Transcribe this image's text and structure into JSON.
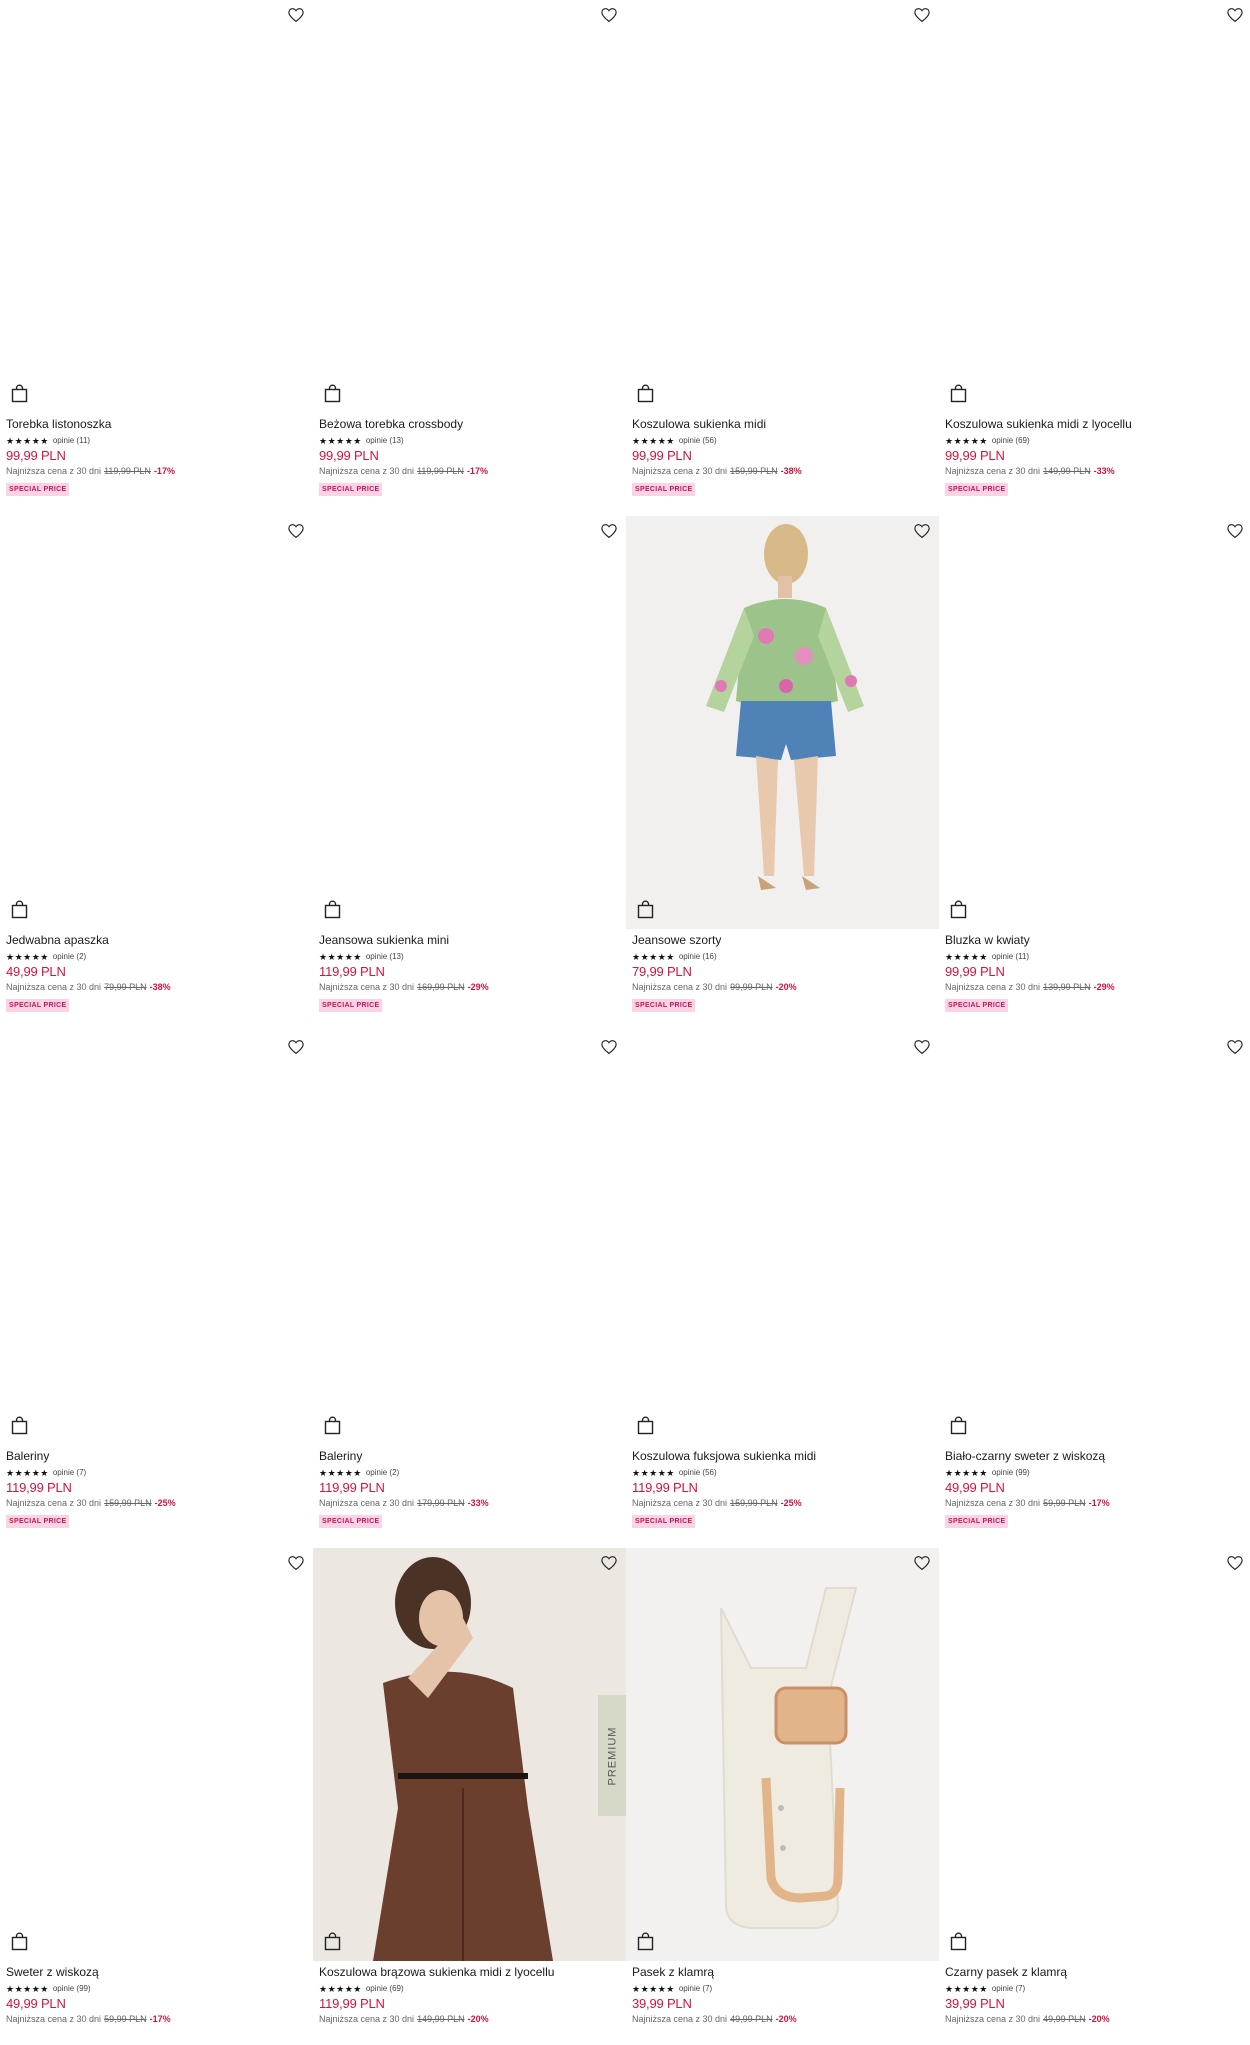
{
  "lowest_label": "Najniższa cena z 30 dni",
  "badge_label": "SPECIAL PRICE",
  "premium_label": "PREMIUM",
  "products": [
    {
      "name": "Torebka listonoszka",
      "stars": "★★★★★",
      "reviews": "opinie (11)",
      "price": "99,99 PLN",
      "old_price": "119,99 PLN",
      "discount": "-17%",
      "badge": true
    },
    {
      "name": "Beżowa torebka crossbody",
      "stars": "★★★★★",
      "reviews": "opinie (13)",
      "price": "99,99 PLN",
      "old_price": "119,99 PLN",
      "discount": "-17%",
      "badge": true
    },
    {
      "name": "Koszulowa sukienka midi",
      "stars": "★★★★★",
      "reviews": "opinie (56)",
      "price": "99,99 PLN",
      "old_price": "159,99 PLN",
      "discount": "-38%",
      "badge": true
    },
    {
      "name": "Koszulowa sukienka midi z lyocellu",
      "stars": "★★★★★",
      "reviews": "opinie (69)",
      "price": "99,99 PLN",
      "old_price": "149,99 PLN",
      "discount": "-33%",
      "badge": true
    },
    {
      "name": "Jedwabna apaszka",
      "stars": "★★★★★",
      "reviews": "opinie (2)",
      "price": "49,99 PLN",
      "old_price": "79,99 PLN",
      "discount": "-38%",
      "badge": true
    },
    {
      "name": "Jeansowa sukienka mini",
      "stars": "★★★★★",
      "reviews": "opinie (13)",
      "price": "119,99 PLN",
      "old_price": "169,99 PLN",
      "discount": "-29%",
      "badge": true
    },
    {
      "name": "Jeansowe szorty",
      "stars": "★★★★★",
      "reviews": "opinie (16)",
      "price": "79,99 PLN",
      "old_price": "99,99 PLN",
      "discount": "-20%",
      "badge": true,
      "image": "model-floral-blouse"
    },
    {
      "name": "Bluzka w kwiaty",
      "stars": "★★★★★",
      "reviews": "opinie (11)",
      "price": "99,99 PLN",
      "old_price": "139,99 PLN",
      "discount": "-29%",
      "badge": true
    },
    {
      "name": "Baleriny",
      "stars": "★★★★★",
      "reviews": "opinie (7)",
      "price": "119,99 PLN",
      "old_price": "159,99 PLN",
      "discount": "-25%",
      "badge": true
    },
    {
      "name": "Baleriny",
      "stars": "★★★★★",
      "reviews": "opinie (2)",
      "price": "119,99 PLN",
      "old_price": "179,99 PLN",
      "discount": "-33%",
      "badge": true
    },
    {
      "name": "Koszulowa fuksjowa sukienka midi",
      "stars": "★★★★★",
      "reviews": "opinie (56)",
      "price": "119,99 PLN",
      "old_price": "159,99 PLN",
      "discount": "-25%",
      "badge": true
    },
    {
      "name": "Biało-czarny sweter z wiskozą",
      "stars": "★★★★★",
      "reviews": "opinie (99)",
      "price": "49,99 PLN",
      "old_price": "59,99 PLN",
      "discount": "-17%",
      "badge": true
    },
    {
      "name": "Sweter z wiskozą",
      "stars": "★★★★★",
      "reviews": "opinie (99)",
      "price": "49,99 PLN",
      "old_price": "59,99 PLN",
      "discount": "-17%",
      "badge": false
    },
    {
      "name": "Koszulowa brązowa sukienka midi z lyocellu",
      "stars": "★★★★★",
      "reviews": "opinie (69)",
      "price": "119,99 PLN",
      "old_price": "149,99 PLN",
      "discount": "-20%",
      "badge": false,
      "image": "model-brown-dress",
      "premium": true
    },
    {
      "name": "Pasek z klamrą",
      "stars": "★★★★★",
      "reviews": "opinie (7)",
      "price": "39,99 PLN",
      "old_price": "49,99 PLN",
      "discount": "-20%",
      "badge": false,
      "image": "cream-belt"
    },
    {
      "name": "Czarny pasek z klamrą",
      "stars": "★★★★★",
      "reviews": "opinie (7)",
      "price": "39,99 PLN",
      "old_price": "49,99 PLN",
      "discount": "-20%",
      "badge": false
    }
  ],
  "colors": {
    "price": "#d4143c",
    "badge_bg": "#fbd3e4",
    "badge_text": "#c8145a"
  }
}
